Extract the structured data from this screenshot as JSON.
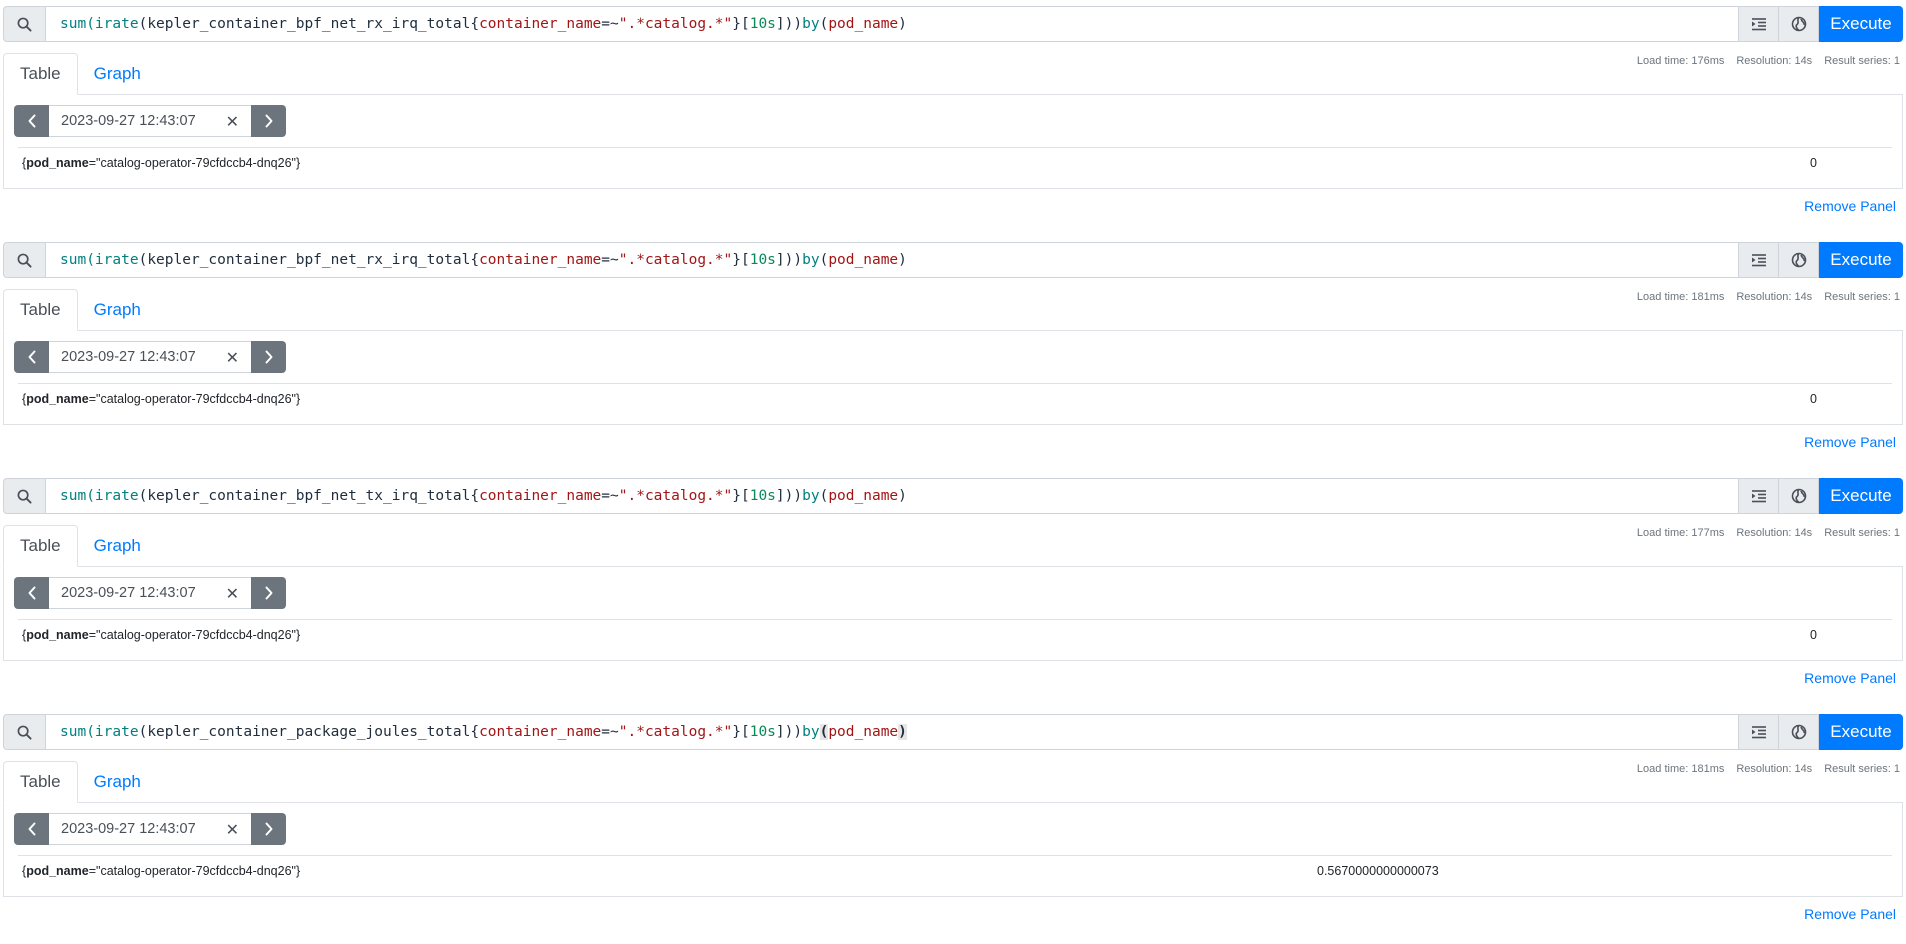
{
  "execute_label": "Execute",
  "tab_table": "Table",
  "tab_graph": "Graph",
  "remove_label": "Remove Panel",
  "panels": [
    {
      "query": {
        "fn1": "sum(",
        "fn2": "irate",
        "p1": "(",
        "metric": "kepler_container_bpf_net_rx_irq_total",
        "lbrace": "{",
        "label": "container_name",
        "op": "=~",
        "str": "\".*catalog.*\"",
        "rbrace": "}",
        "lbr": "[",
        "dur": "10s",
        "tail": "])) ",
        "kw": "by",
        "sp": " ",
        "po": "(",
        "grp": "pod_name",
        "pc": ")"
      },
      "load": "Load time: 176ms",
      "resolution": "Resolution: 14s",
      "result": "Result series: 1",
      "time": "2023-09-27 12:43:07",
      "series_open": "{",
      "series_label": "pod_name",
      "series_value": "=\"catalog-operator-79cfdccb4-dnq26\"}",
      "value": "0"
    },
    {
      "query": {
        "fn1": "sum(",
        "fn2": "irate",
        "p1": "(",
        "metric": "kepler_container_bpf_net_rx_irq_total",
        "lbrace": "{",
        "label": "container_name",
        "op": "=~",
        "str": "\".*catalog.*\"",
        "rbrace": "}",
        "lbr": "[",
        "dur": "10s",
        "tail": "])) ",
        "kw": "by",
        "sp": " ",
        "po": "(",
        "grp": "pod_name",
        "pc": ")"
      },
      "load": "Load time: 181ms",
      "resolution": "Resolution: 14s",
      "result": "Result series: 1",
      "time": "2023-09-27 12:43:07",
      "series_open": "{",
      "series_label": "pod_name",
      "series_value": "=\"catalog-operator-79cfdccb4-dnq26\"}",
      "value": "0"
    },
    {
      "query": {
        "fn1": "sum(",
        "fn2": "irate",
        "p1": "(",
        "metric": "kepler_container_bpf_net_tx_irq_total",
        "lbrace": "{",
        "label": "container_name",
        "op": "=~",
        "str": "\".*catalog.*\"",
        "rbrace": "}",
        "lbr": "[",
        "dur": "10s",
        "tail": "])) ",
        "kw": "by",
        "sp": " ",
        "po": "(",
        "grp": "pod_name",
        "pc": ")"
      },
      "load": "Load time: 177ms",
      "resolution": "Resolution: 14s",
      "result": "Result series: 1",
      "time": "2023-09-27 12:43:07",
      "series_open": "{",
      "series_label": "pod_name",
      "series_value": "=\"catalog-operator-79cfdccb4-dnq26\"}",
      "value": "0"
    },
    {
      "query": {
        "fn1": "sum(",
        "fn2": "irate",
        "p1": "(",
        "metric": "kepler_container_package_joules_total",
        "lbrace": "{",
        "label": "container_name",
        "op": "=~",
        "str": "\".*catalog.*\"",
        "rbrace": "}",
        "lbr": "[",
        "dur": "10s",
        "tail": "])) ",
        "kw": "by",
        "sp": " ",
        "po": "(",
        "grp": "pod_name",
        "pc": ")"
      },
      "load": "Load time: 181ms",
      "resolution": "Resolution: 14s",
      "result": "Result series: 1",
      "time": "2023-09-27 12:43:07",
      "series_open": "{",
      "series_label": "pod_name",
      "series_value": "=\"catalog-operator-79cfdccb4-dnq26\"}",
      "value": "0.5670000000000073"
    }
  ]
}
